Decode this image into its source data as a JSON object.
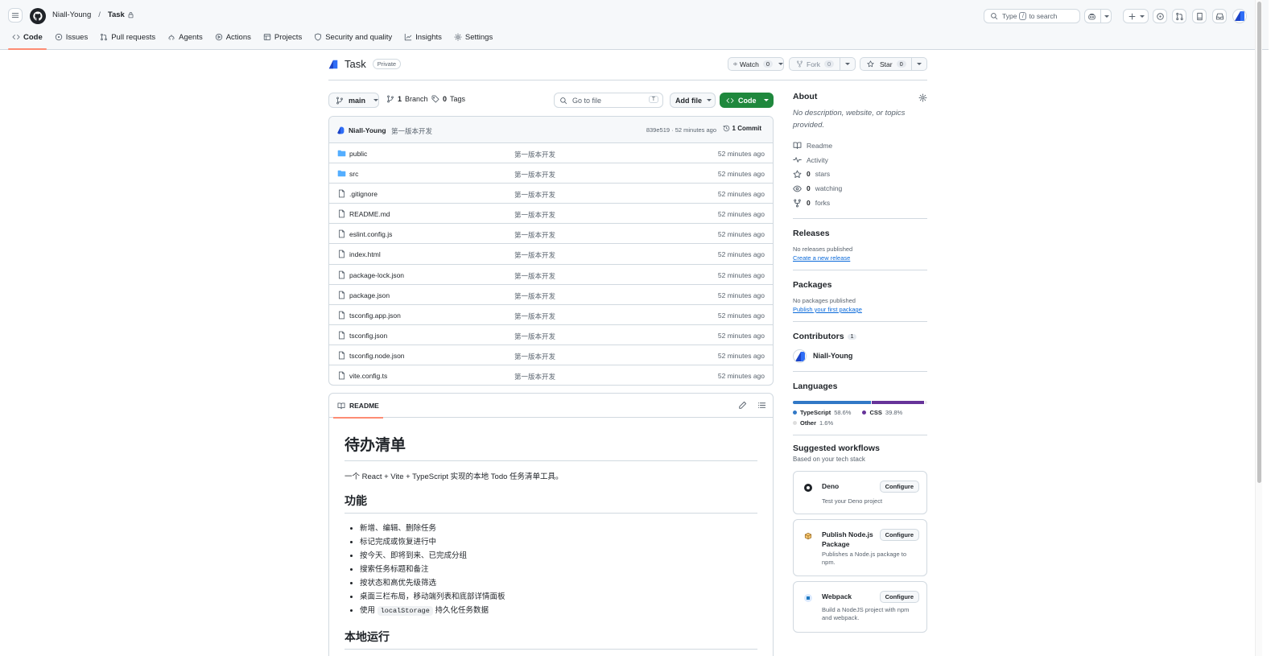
{
  "header": {
    "owner": "Niall-Young",
    "separator": "/",
    "repo": "Task",
    "search_prefix": "Type",
    "search_key": "/",
    "search_suffix": "to search"
  },
  "tabs": [
    {
      "label": "Code",
      "icon": "code-icon",
      "active": true
    },
    {
      "label": "Issues",
      "icon": "issue-icon"
    },
    {
      "label": "Pull requests",
      "icon": "pull-request-icon"
    },
    {
      "label": "Agents",
      "icon": "agents-icon"
    },
    {
      "label": "Actions",
      "icon": "play-icon"
    },
    {
      "label": "Projects",
      "icon": "table-icon"
    },
    {
      "label": "Security and quality",
      "icon": "shield-icon"
    },
    {
      "label": "Insights",
      "icon": "graph-icon"
    },
    {
      "label": "Settings",
      "icon": "gear-icon"
    }
  ],
  "repo": {
    "name": "Task",
    "visibility": "Private",
    "watch_label": "Watch",
    "watch_count": "0",
    "fork_label": "Fork",
    "fork_count": "0",
    "star_label": "Star",
    "star_count": "0"
  },
  "toolbar": {
    "branch": "main",
    "branches_count": "1",
    "branches_label": "Branch",
    "tags_count": "0",
    "tags_label": "Tags",
    "goto_placeholder": "Go to file",
    "goto_key": "T",
    "add_file": "Add file",
    "code_button": "Code"
  },
  "commit": {
    "author": "Niall-Young",
    "message": "第一版本开发",
    "sha_time": "839e519 · 52 minutes ago",
    "commits_label": "1 Commit"
  },
  "files": [
    {
      "name": "public",
      "type": "dir",
      "message": "第一版本开发",
      "time": "52 minutes ago"
    },
    {
      "name": "src",
      "type": "dir",
      "message": "第一版本开发",
      "time": "52 minutes ago"
    },
    {
      "name": ".gitignore",
      "type": "file",
      "message": "第一版本开发",
      "time": "52 minutes ago"
    },
    {
      "name": "README.md",
      "type": "file",
      "message": "第一版本开发",
      "time": "52 minutes ago"
    },
    {
      "name": "eslint.config.js",
      "type": "file",
      "message": "第一版本开发",
      "time": "52 minutes ago"
    },
    {
      "name": "index.html",
      "type": "file",
      "message": "第一版本开发",
      "time": "52 minutes ago"
    },
    {
      "name": "package-lock.json",
      "type": "file",
      "message": "第一版本开发",
      "time": "52 minutes ago"
    },
    {
      "name": "package.json",
      "type": "file",
      "message": "第一版本开发",
      "time": "52 minutes ago"
    },
    {
      "name": "tsconfig.app.json",
      "type": "file",
      "message": "第一版本开发",
      "time": "52 minutes ago"
    },
    {
      "name": "tsconfig.json",
      "type": "file",
      "message": "第一版本开发",
      "time": "52 minutes ago"
    },
    {
      "name": "tsconfig.node.json",
      "type": "file",
      "message": "第一版本开发",
      "time": "52 minutes ago"
    },
    {
      "name": "vite.config.ts",
      "type": "file",
      "message": "第一版本开发",
      "time": "52 minutes ago"
    }
  ],
  "readme": {
    "tab_label": "README",
    "title": "待办清单",
    "intro": "一个 React + Vite + TypeScript 实现的本地 Todo 任务清单工具。",
    "features_heading": "功能",
    "features": [
      "新增、编辑、删除任务",
      "标记完成或恢复进行中",
      "按今天、即将到来、已完成分组",
      "搜索任务标题和备注",
      "按状态和高优先级筛选",
      "桌面三栏布局，移动端列表和底部详情面板"
    ],
    "last_feature_prefix": "使用",
    "last_feature_code": "localStorage",
    "last_feature_suffix": "持久化任务数据",
    "run_heading": "本地运行"
  },
  "about": {
    "heading": "About",
    "description": "No description, website, or topics provided.",
    "items": [
      {
        "icon": "book-icon",
        "value": "",
        "label": "Readme"
      },
      {
        "icon": "pulse-icon",
        "value": "",
        "label": "Activity"
      },
      {
        "icon": "star-icon",
        "value": "0",
        "label": "stars"
      },
      {
        "icon": "eye-icon",
        "value": "0",
        "label": "watching"
      },
      {
        "icon": "fork-icon",
        "value": "0",
        "label": "forks"
      }
    ]
  },
  "releases": {
    "heading": "Releases",
    "empty": "No releases published",
    "link": "Create a new release"
  },
  "packages": {
    "heading": "Packages",
    "empty": "No packages published",
    "link": "Publish your first package"
  },
  "contributors": {
    "heading": "Contributors",
    "count": "1",
    "people": [
      {
        "name": "Niall-Young"
      }
    ]
  },
  "languages": {
    "heading": "Languages",
    "items": [
      {
        "name": "TypeScript",
        "percent": "58.6%",
        "share": 58.6,
        "color": "#3178c6"
      },
      {
        "name": "CSS",
        "percent": "39.8%",
        "share": 39.8,
        "color": "#663399"
      },
      {
        "name": "Other",
        "percent": "1.6%",
        "share": 1.6,
        "color": "#ededed"
      }
    ]
  },
  "workflows": {
    "heading": "Suggested workflows",
    "subheading": "Based on your tech stack",
    "configure_label": "Configure",
    "items": [
      {
        "name": "Deno",
        "description": "Test your Deno project",
        "icon": "deno-icon"
      },
      {
        "name": "Publish Node.js Package",
        "description": "Publishes a Node.js package to npm.",
        "icon": "package-icon"
      },
      {
        "name": "Webpack",
        "description": "Build a NodeJS project with npm and webpack.",
        "icon": "webpack-icon"
      }
    ]
  },
  "colors": {
    "accent_green": "#1f883d",
    "tab_underline": "#fd8c73",
    "link": "#0969da"
  }
}
